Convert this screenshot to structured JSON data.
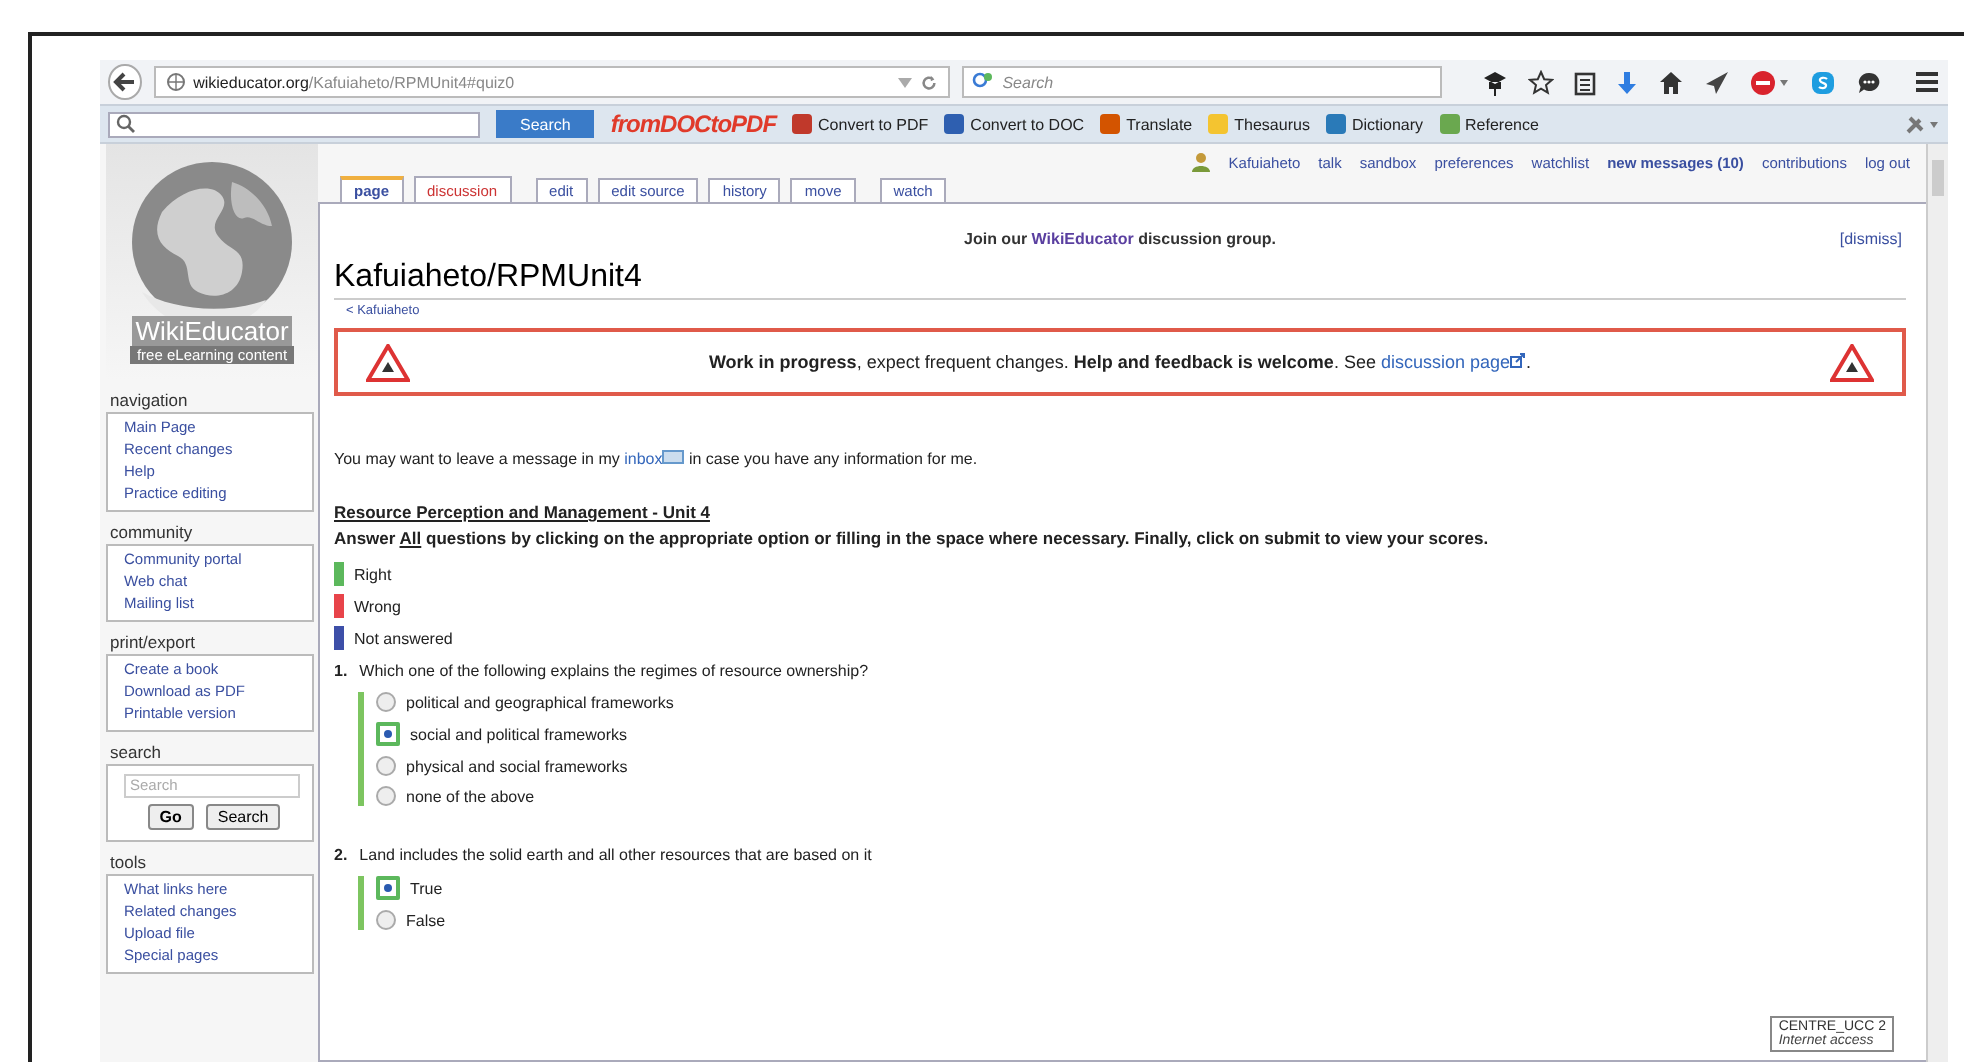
{
  "browser": {
    "url_domain": "wikieducator.org",
    "url_path": "/Kafuiaheto/RPMUnit4#quiz0",
    "search_placeholder": "Search"
  },
  "toolbar": {
    "search_button": "Search",
    "brand": "fromDOCtoPDF",
    "items": [
      {
        "label": "Convert to PDF",
        "color": "#c0392b"
      },
      {
        "label": "Convert to DOC",
        "color": "#2e5fb0"
      },
      {
        "label": "Translate",
        "color": "#d35400"
      },
      {
        "label": "Thesaurus",
        "color": "#f4c430"
      },
      {
        "label": "Dictionary",
        "color": "#2a7ab8"
      },
      {
        "label": "Reference",
        "color": "#6aa84f"
      }
    ]
  },
  "sidebar": {
    "logo_title": "WikiEducator",
    "logo_tagline": "free eLearning content",
    "portals": [
      {
        "kind": "links",
        "heading": "navigation",
        "items": [
          "Main Page",
          "Recent changes",
          "Help",
          "Practice editing"
        ]
      },
      {
        "kind": "links",
        "heading": "community",
        "items": [
          "Community portal",
          "Web chat",
          "Mailing list"
        ]
      },
      {
        "kind": "links",
        "heading": "print/export",
        "items": [
          "Create a book",
          "Download as PDF",
          "Printable version"
        ]
      },
      {
        "kind": "search",
        "heading": "search",
        "placeholder": "Search",
        "buttons": [
          "Go",
          "Search"
        ]
      },
      {
        "kind": "links",
        "heading": "tools",
        "items": [
          "What links here",
          "Related changes",
          "Upload file",
          "Special pages"
        ]
      }
    ]
  },
  "user_links": [
    {
      "label": "Kafuiaheto",
      "bold": false
    },
    {
      "label": "talk",
      "bold": false
    },
    {
      "label": "sandbox",
      "bold": false
    },
    {
      "label": "preferences",
      "bold": false
    },
    {
      "label": "watchlist",
      "bold": false
    },
    {
      "label": "new messages (10)",
      "bold": true
    },
    {
      "label": "contributions",
      "bold": false
    },
    {
      "label": "log out",
      "bold": false
    }
  ],
  "tab_groups": [
    [
      {
        "label": "page",
        "selected": true,
        "missing": false
      },
      {
        "label": "discussion",
        "selected": false,
        "missing": true
      }
    ],
    [
      {
        "label": "edit",
        "selected": false,
        "missing": false
      },
      {
        "label": "edit source",
        "selected": false,
        "missing": false
      },
      {
        "label": "history",
        "selected": false,
        "missing": false
      },
      {
        "label": "move",
        "selected": false,
        "missing": false
      }
    ],
    [
      {
        "label": "watch",
        "selected": false,
        "missing": false
      }
    ]
  ],
  "sitenotice": {
    "before": "Join our",
    "link": "WikiEducator",
    "after": "discussion group.",
    "dismiss": "[dismiss]"
  },
  "title": "Kafuiaheto/RPMUnit4",
  "breadcrumb": "< Kafuiaheto",
  "banner": {
    "text": "**Work in progress**, expect frequent changes. **Help and feedback is welcome**. See",
    "link": "discussion page",
    "after": "."
  },
  "intro": {
    "before": "You may want to leave a message in my",
    "link": "inbox",
    "after": "in case you have any information for me."
  },
  "quiz": {
    "heading": "Resource Perception and Management - Unit 4",
    "instructions": {
      "before": "Answer",
      "underlined": "All",
      "after": "questions by clicking on the appropriate option or filling in the space where necessary. Finally, click on submit to view your scores."
    },
    "legend": [
      {
        "label": "Right",
        "color": "#5cb85c"
      },
      {
        "label": "Wrong",
        "color": "#e8444a"
      },
      {
        "label": "Not answered",
        "color": "#3d4fa8"
      }
    ],
    "questions": [
      {
        "number": "1.",
        "text": "Which one of the following explains the regimes of resource ownership?",
        "options": [
          {
            "label": "political and geographical frameworks",
            "selected": false
          },
          {
            "label": "social and political frameworks",
            "selected": true
          },
          {
            "label": "physical and social frameworks",
            "selected": false
          },
          {
            "label": "none of the above",
            "selected": false
          }
        ]
      },
      {
        "number": "2.",
        "text": "Land includes the solid earth and all other resources that are based on it",
        "options": [
          {
            "label": "True",
            "selected": true
          },
          {
            "label": "False",
            "selected": false
          }
        ]
      }
    ]
  },
  "network_tooltip": {
    "name": "CENTRE_UCC 2",
    "status": "Internet access"
  }
}
